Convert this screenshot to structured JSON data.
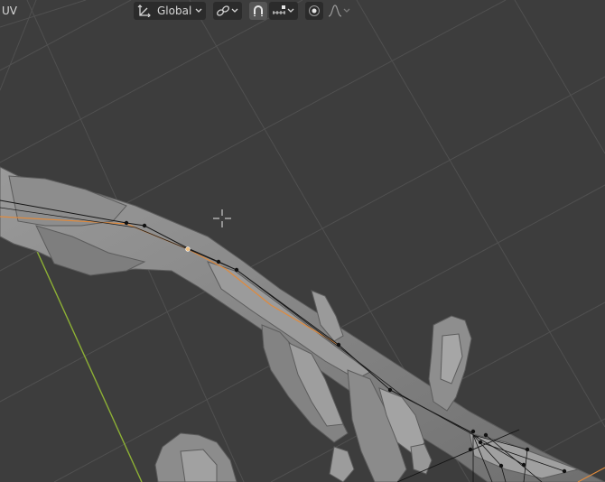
{
  "header": {
    "mode_label": "UV",
    "orientation": {
      "label": "Global",
      "icon": "transform-orientation-icon",
      "dropdown_icon": "chevron-down-icon"
    },
    "pivot": {
      "icon": "pivot-point-link-icon",
      "dropdown_icon": "chevron-down-icon"
    },
    "snap": {
      "icon": "magnet-snap-icon",
      "active": true,
      "element_icon": "snap-increment-icon",
      "dropdown_icon": "chevron-down-icon"
    },
    "proportional_edit": {
      "icon": "proportional-edit-icon",
      "falloff_icon": "falloff-curve-icon",
      "dropdown_icon": "chevron-down-icon"
    }
  },
  "viewport": {
    "cursor_icon": "3d-cursor-crosshair-icon",
    "colors": {
      "background": "#3d3d3d",
      "grid": "#4f4f4f",
      "y_axis": "#8db035",
      "mesh": "#8a8a8a",
      "bone_active": "#e08a3c",
      "bone_wire": "#111111"
    }
  }
}
